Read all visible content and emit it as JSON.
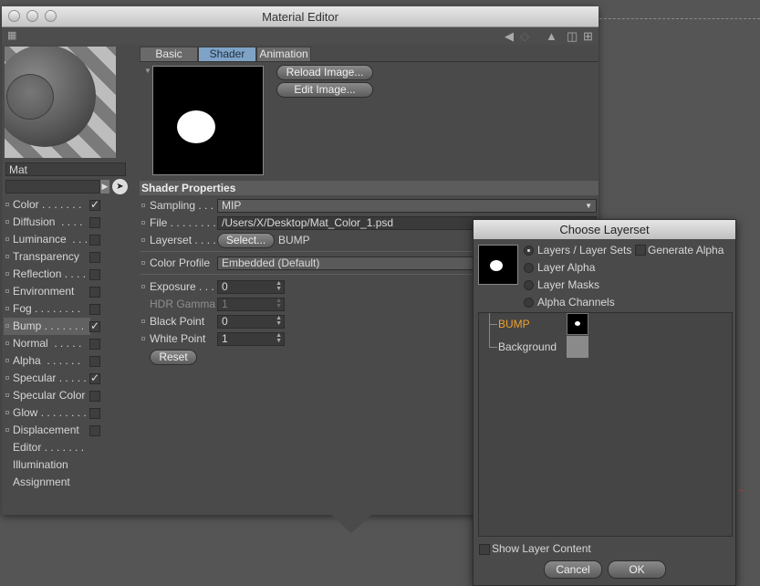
{
  "material_editor": {
    "title": "Material Editor",
    "material_name": "Mat",
    "channels": [
      {
        "label": "Color . . . . . . . ",
        "checked": true
      },
      {
        "label": "Diffusion  . . . . ",
        "checked": false
      },
      {
        "label": "Luminance  . . . ",
        "checked": false
      },
      {
        "label": "Transparency  ",
        "checked": false
      },
      {
        "label": "Reflection . . . . ",
        "checked": false
      },
      {
        "label": "Environment ",
        "checked": false
      },
      {
        "label": "Fog . . . . . . . . ",
        "checked": false
      },
      {
        "label": "Bump . . . . . . . ",
        "checked": true,
        "selected": true
      },
      {
        "label": "Normal  . . . . . ",
        "checked": false
      },
      {
        "label": "Alpha  . . . . . . ",
        "checked": false
      },
      {
        "label": "Specular . . . . . ",
        "checked": true
      },
      {
        "label": "Specular Color ",
        "checked": false
      },
      {
        "label": "Glow . . . . . . . . ",
        "checked": false
      },
      {
        "label": "Displacement ",
        "checked": false
      },
      {
        "label": "Editor . . . . . . . ",
        "checked": null
      },
      {
        "label": "Illumination",
        "checked": null
      },
      {
        "label": "Assignment",
        "checked": null
      }
    ],
    "tabs": [
      "Basic",
      "Shader",
      "Animation"
    ],
    "active_tab": "Shader",
    "reload_image_label": "Reload Image...",
    "edit_image_label": "Edit Image...",
    "shader_properties_title": "Shader Properties",
    "props": {
      "sampling_label": "Sampling . . .",
      "sampling_value": "MIP",
      "file_label": "File . . . . . . . .",
      "file_value": "/Users/X/Desktop/Mat_Color_1.psd",
      "layerset_label": "Layerset . . . .",
      "layerset_button": "Select...",
      "layerset_value": "BUMP",
      "color_profile_label": "Color Profile",
      "color_profile_value": "Embedded (Default)",
      "exposure_label": "Exposure . . .",
      "exposure_value": "0",
      "hdr_gamma_label": "HDR Gamma",
      "hdr_gamma_value": "1",
      "black_point_label": "Black Point",
      "black_point_value": "0",
      "white_point_label": "White Point",
      "white_point_value": "1",
      "reset_label": "Reset"
    }
  },
  "layerset_dialog": {
    "title": "Choose Layerset",
    "options": [
      {
        "label": "Layers / Layer Sets",
        "selected": true
      },
      {
        "label": "Layer Alpha",
        "selected": false
      },
      {
        "label": "Layer Masks",
        "selected": false
      },
      {
        "label": "Alpha Channels",
        "selected": false
      }
    ],
    "generate_alpha_label": "Generate Alpha",
    "layers": [
      {
        "name": "BUMP",
        "active": true
      },
      {
        "name": "Background",
        "active": false
      }
    ],
    "show_layer_content_label": "Show Layer Content",
    "cancel_label": "Cancel",
    "ok_label": "OK"
  },
  "colors": {
    "active_tab": "#7fa3c6",
    "active_layer": "#f0a030",
    "window_bg": "#4a4a4a"
  }
}
